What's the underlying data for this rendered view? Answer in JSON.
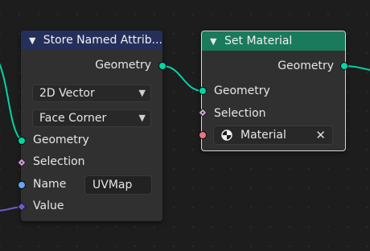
{
  "store_node": {
    "title": "Store Named Attrib...",
    "output_geometry": "Geometry",
    "data_type": "2D Vector",
    "domain": "Face Corner",
    "inputs": {
      "geometry": "Geometry",
      "selection": "Selection",
      "name": "Name",
      "name_value": "UVMap",
      "value": "Value"
    }
  },
  "set_material_node": {
    "title": "Set Material",
    "output_geometry": "Geometry",
    "inputs": {
      "geometry": "Geometry",
      "selection": "Selection",
      "material": "Material"
    }
  },
  "colors": {
    "geometry_socket": "#00d6a3",
    "string_socket": "#64a8f4",
    "material_socket": "#eb7582",
    "selection_socket": "#d1a5dc",
    "vector_socket": "#6d5ecf",
    "store_header": "#24305a",
    "set_material_header": "#197a5c"
  },
  "icons": {
    "collapse": "chevron-down-icon",
    "dropdown": "chevron-down-icon",
    "material": "material-sphere-icon",
    "clear": "x-icon"
  }
}
